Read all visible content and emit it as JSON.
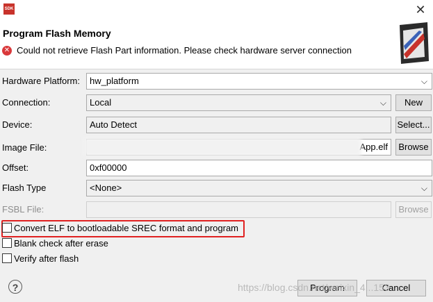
{
  "titlebar": {
    "app_icon_text": "SDK",
    "close_glyph": "✕"
  },
  "header": {
    "title": "Program Flash Memory",
    "error_message": "Could not retrieve Flash Part information. Please check hardware server connection"
  },
  "form": {
    "hardware_platform": {
      "label": "Hardware Platform:",
      "value": "hw_platform"
    },
    "connection": {
      "label": "Connection:",
      "value": "Local",
      "button": "New"
    },
    "device": {
      "label": "Device:",
      "value": "Auto Detect",
      "button": "Select..."
    },
    "image_file": {
      "label": "Image File:",
      "value": "App.elf",
      "button": "Browse"
    },
    "offset": {
      "label": "Offset:",
      "value": "0xf00000"
    },
    "flash_type": {
      "label": "Flash Type",
      "value": "<None>"
    },
    "fsbl_file": {
      "label": "FSBL File:",
      "value": "",
      "button": "Browse"
    }
  },
  "options": [
    {
      "label": "Convert ELF to bootloadable SREC format and program",
      "checked": false
    },
    {
      "label": "Blank check after erase",
      "checked": false
    },
    {
      "label": "Verify after flash",
      "checked": false
    }
  ],
  "footer": {
    "help": "?",
    "program_button": "Program",
    "cancel_button": "Cancel"
  },
  "watermark": "https://blog.csdn.net/weixin_4...153",
  "colors": {
    "highlight": "#e02020",
    "error": "#d9393b",
    "app_icon": "#c8332b"
  }
}
